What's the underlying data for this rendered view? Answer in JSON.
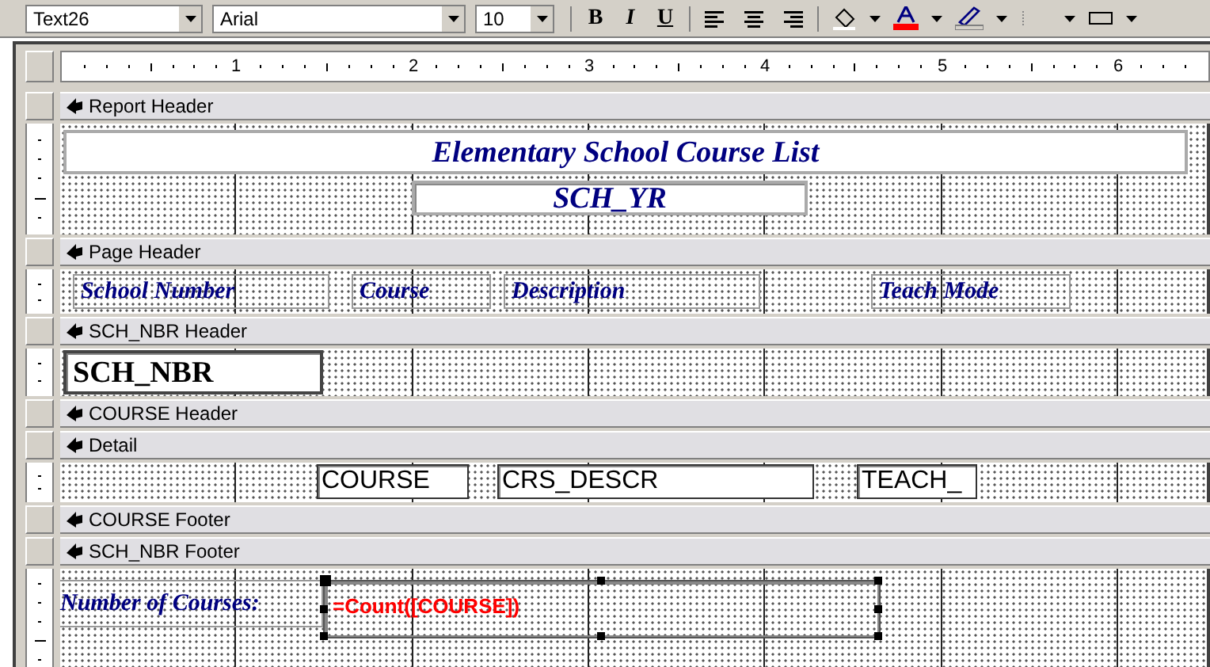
{
  "toolbar": {
    "object_box": "Text26",
    "font_box": "Arial",
    "size_box": "10",
    "format_buttons": [
      "B",
      "I",
      "U"
    ]
  },
  "ruler": [
    "1",
    "2",
    "3",
    "4",
    "5",
    "6"
  ],
  "sections": [
    {
      "title": "Report Header",
      "controls": [
        {
          "kind": "label",
          "text": "Elementary School Course List",
          "selected": false
        },
        {
          "kind": "textbox",
          "text": "SCH_YR",
          "selected": false
        }
      ]
    },
    {
      "title": "Page Header",
      "controls": [
        {
          "kind": "label",
          "text": "School Number",
          "selected": false
        },
        {
          "kind": "label",
          "text": "Course",
          "selected": false
        },
        {
          "kind": "label",
          "text": "Description",
          "selected": false
        },
        {
          "kind": "label",
          "text": "Teach Mode",
          "selected": false
        }
      ]
    },
    {
      "title": "SCH_NBR Header",
      "controls": [
        {
          "kind": "textbox",
          "text": "SCH_NBR",
          "selected": false
        }
      ]
    },
    {
      "title": "COURSE Header"
    },
    {
      "title": "Detail",
      "controls": [
        {
          "kind": "textbox",
          "text": "COURSE",
          "selected": false
        },
        {
          "kind": "textbox",
          "text": "CRS_DESCR",
          "selected": false
        },
        {
          "kind": "textbox",
          "text": "TEACH_",
          "selected": false
        }
      ]
    },
    {
      "title": "COURSE Footer"
    },
    {
      "title": "SCH_NBR Footer",
      "controls": [
        {
          "kind": "label",
          "text": "Number of Courses:",
          "selected": false
        },
        {
          "kind": "textbox",
          "text": "=Count([COURSE])",
          "selected": true
        }
      ]
    }
  ]
}
